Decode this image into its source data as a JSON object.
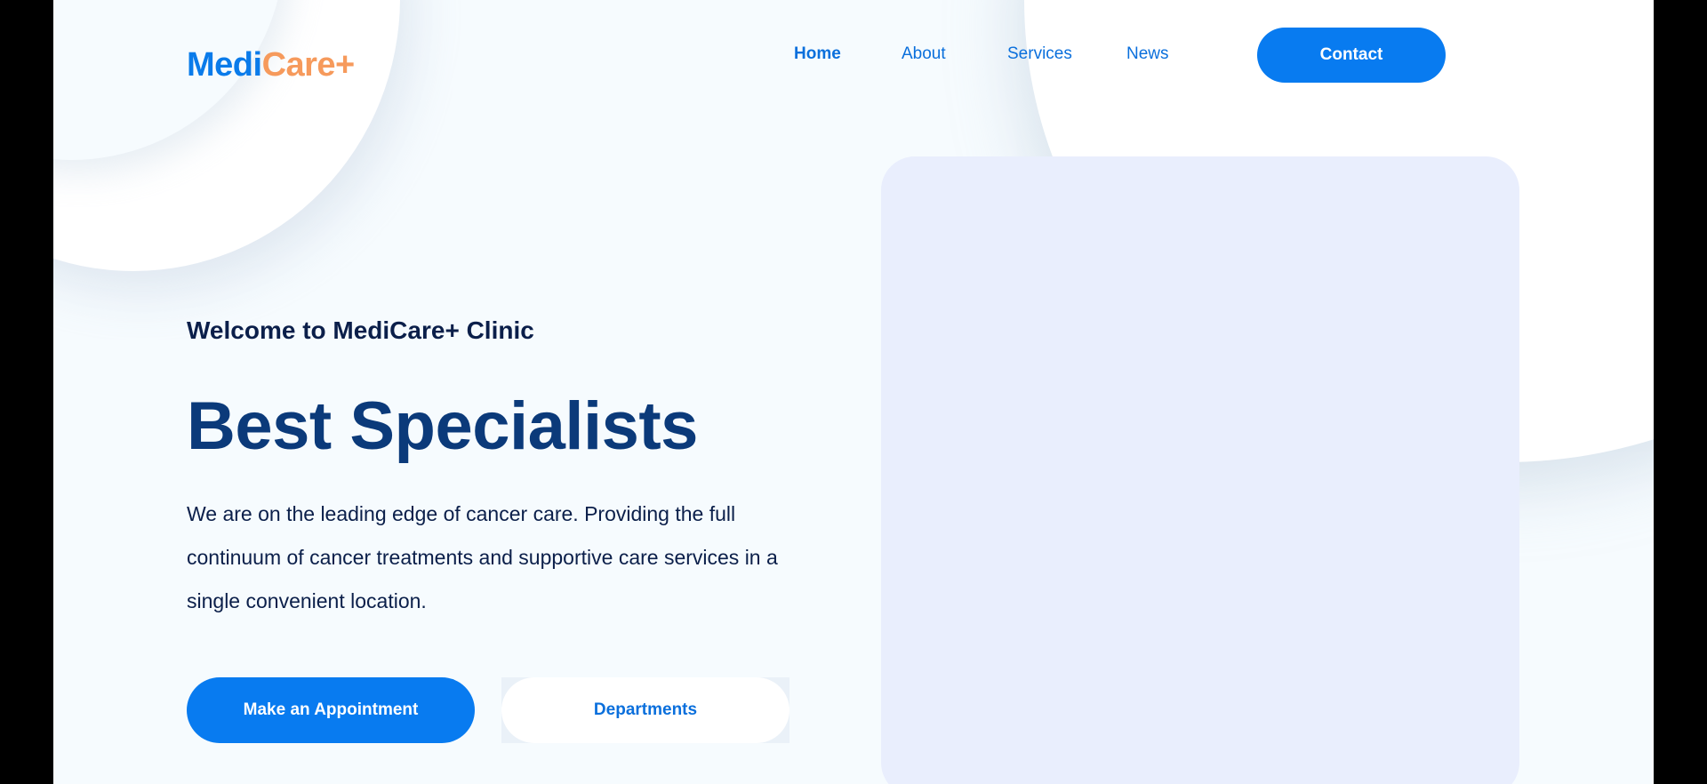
{
  "brand": {
    "logo_part1": "Medi",
    "logo_part2": "Care+",
    "primary_color": "#087bf0",
    "accent_color": "#f69a5c"
  },
  "nav": {
    "items": [
      {
        "label": "Home",
        "active": true
      },
      {
        "label": "About",
        "active": false
      },
      {
        "label": "Services",
        "active": false
      },
      {
        "label": "News",
        "active": false
      }
    ],
    "contact_label": "Contact"
  },
  "hero": {
    "welcome": "Welcome to MediCare+ Clinic",
    "headline": "Best Specialists",
    "description": "We are on the leading edge of cancer care. Providing the full continuum of cancer treatments and supportive care services in a single convenient location.",
    "primary_button": "Make an Appointment",
    "secondary_button": "Departments"
  }
}
